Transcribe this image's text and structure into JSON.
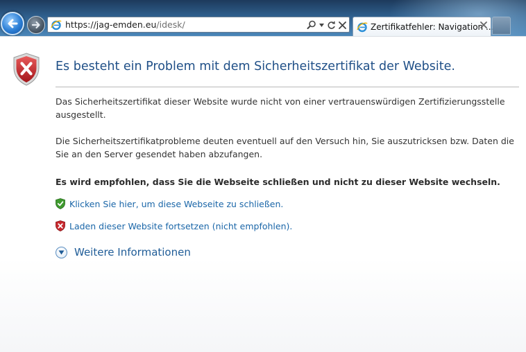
{
  "browser": {
    "address_bar": {
      "url_host": "https://jag-emden.eu",
      "url_path": "/idesk/"
    },
    "tab": {
      "title": "Zertifikatfehler: Navigation ..."
    },
    "icons": {
      "back": "back-arrow-icon",
      "forward": "forward-arrow-icon",
      "site": "internet-explorer-icon",
      "search": "search-icon",
      "dropdown": "chevron-down-icon",
      "refresh": "refresh-icon",
      "stop": "close-icon"
    }
  },
  "page": {
    "title": "Es besteht ein Problem mit dem Sicherheitszertifikat der Website.",
    "paragraph1": "Das Sicherheitszertifikat dieser Website wurde nicht von einer vertrauenswürdigen Zertifizierungsstelle ausgestellt.",
    "paragraph2": "Die Sicherheitszertifikatprobleme deuten eventuell auf den Versuch hin, Sie auszutricksen bzw. Daten die Sie an den Server gesendet haben abzufangen.",
    "recommendation": "Es wird empfohlen, dass Sie die Webseite schließen und nicht zu dieser Website wechseln.",
    "close_link": "Klicken Sie hier, um diese Webseite zu schließen.",
    "continue_link": "Laden dieser Website fortsetzen (nicht empfohlen).",
    "more_info": "Weitere Informationen"
  },
  "colors": {
    "title": "#1f4f87",
    "link": "#1a66a8",
    "error_red": "#c8282d",
    "safe_green": "#3f9a2e"
  }
}
